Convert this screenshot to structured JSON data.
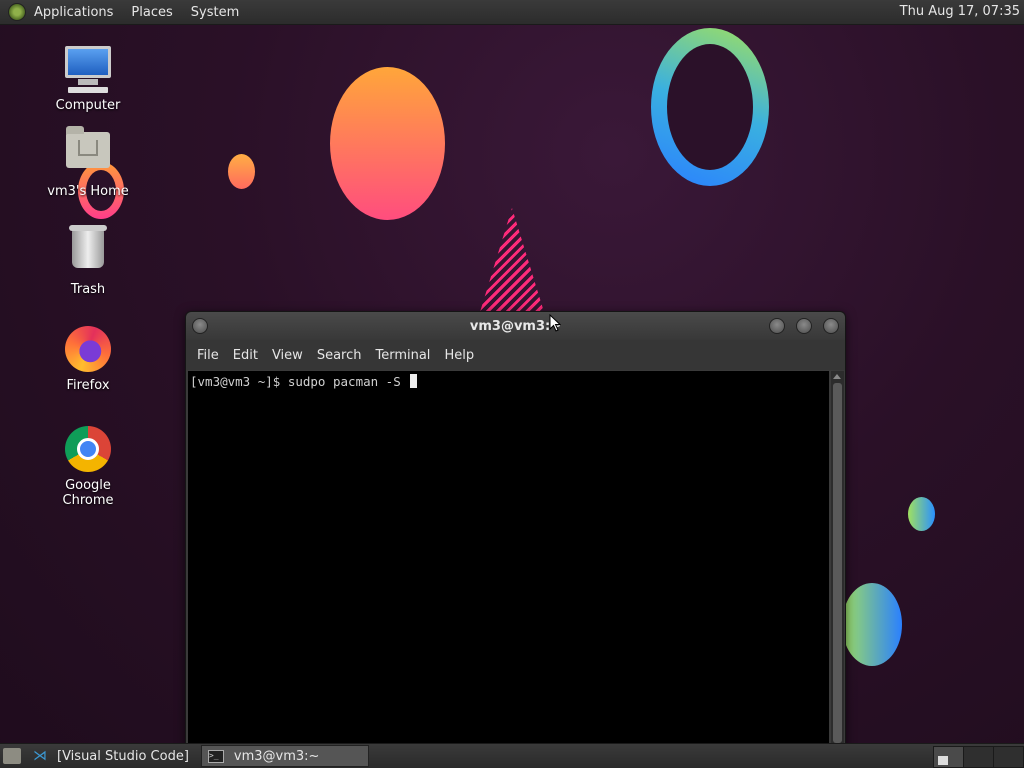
{
  "top_panel": {
    "menus": [
      "Applications",
      "Places",
      "System"
    ],
    "clock": "Thu Aug 17, 07:35"
  },
  "desktop_icons": [
    {
      "label": "Computer"
    },
    {
      "label": "vm3's Home"
    },
    {
      "label": "Trash"
    },
    {
      "label": "Firefox"
    },
    {
      "label": "Google Chrome"
    }
  ],
  "terminal_window": {
    "title": "vm3@vm3:~",
    "menu": [
      "File",
      "Edit",
      "View",
      "Search",
      "Terminal",
      "Help"
    ],
    "prompt_line": "[vm3@vm3 ~]$ sudpo pacman -S "
  },
  "taskbar": {
    "tasks": [
      {
        "label": "[Visual Studio Code]",
        "icon": "vscode-icon",
        "active": false
      },
      {
        "label": "vm3@vm3:~",
        "icon": "terminal-icon",
        "active": true
      }
    ],
    "workspaces": 3
  }
}
